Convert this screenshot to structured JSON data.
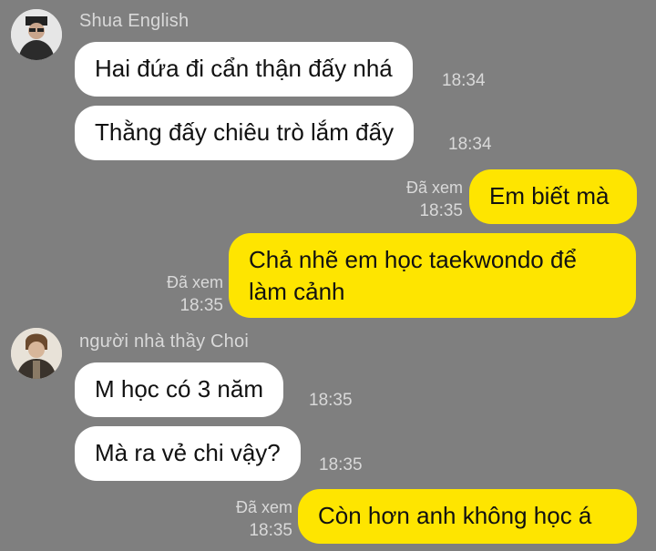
{
  "groups": [
    {
      "sender": "Shua English",
      "messages": [
        {
          "text": "Hai đứa đi cẩn thận đấy nhá",
          "time": "18:34"
        },
        {
          "text": "Thằng đấy chiêu trò lắm đấy",
          "time": "18:34"
        }
      ]
    },
    {
      "sender": "người nhà thầy Choi",
      "messages": [
        {
          "text": "M học có 3 năm",
          "time": "18:35"
        },
        {
          "text": "Mà ra vẻ chi vậy?",
          "time": "18:35"
        }
      ]
    }
  ],
  "outgoing": [
    {
      "text": "Em biết mà",
      "status": "Đã xem",
      "time": "18:35"
    },
    {
      "text": "Chả nhẽ em học taekwondo để làm cảnh",
      "status": "Đã xem",
      "time": "18:35"
    },
    {
      "text": "Còn hơn anh không học á",
      "status": "Đã xem",
      "time": "18:35"
    }
  ],
  "colors": {
    "background": "#7f7f7f",
    "incoming_bubble": "#ffffff",
    "outgoing_bubble": "#fee500",
    "meta_text": "#d9d9d9"
  }
}
